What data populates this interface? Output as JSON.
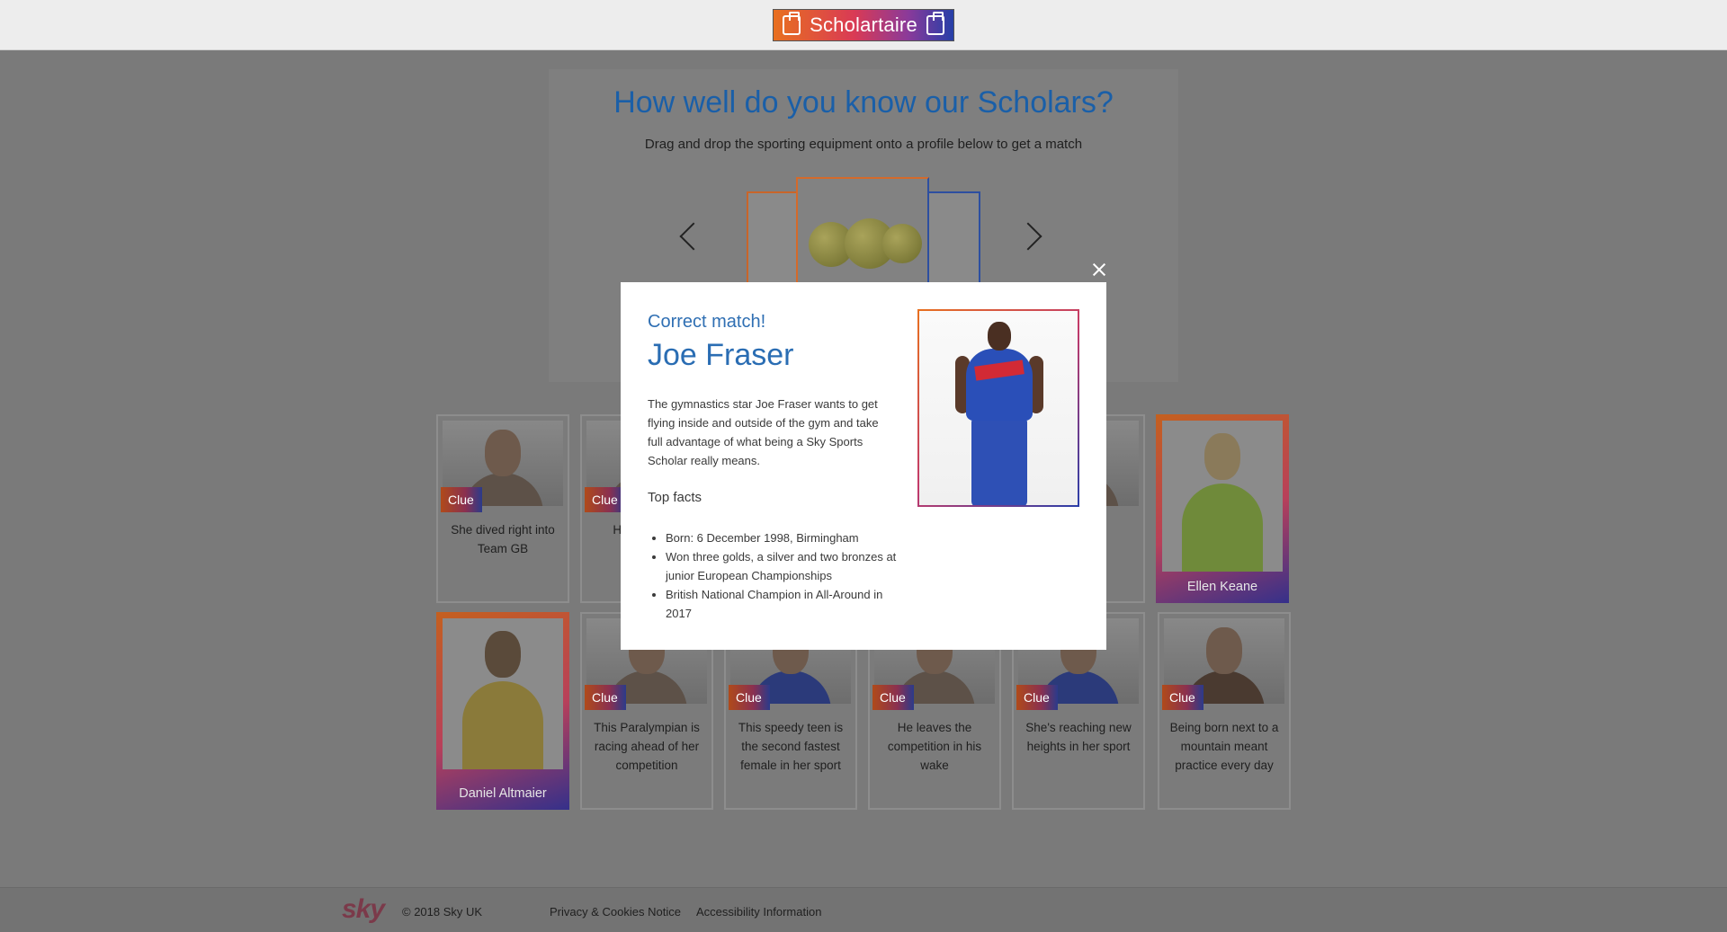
{
  "header": {
    "logo_text": "Scholartaire"
  },
  "game": {
    "title": "How well do you know our Scholars?",
    "subtitle": "Drag and drop the sporting equipment onto a profile below to get a match"
  },
  "cards_row1": [
    {
      "clue": "Clue",
      "hint": "She dived right into Team GB"
    },
    {
      "clue": "Clue",
      "hint": "He's... afte..."
    },
    {
      "name": "Ellen Keane"
    }
  ],
  "cards_row2": [
    {
      "name": "Daniel Altmaier"
    },
    {
      "clue": "Clue",
      "hint": "This Paralympian is racing ahead of her competition"
    },
    {
      "clue": "Clue",
      "hint": "This speedy teen is the second fastest female in her sport"
    },
    {
      "clue": "Clue",
      "hint": "He leaves the competition in his wake"
    },
    {
      "clue": "Clue",
      "hint": "She's reaching new heights in her sport"
    },
    {
      "clue": "Clue",
      "hint": "Being born next to a mountain meant practice every day"
    }
  ],
  "modal": {
    "status": "Correct match!",
    "name": "Joe Fraser",
    "description": "The gymnastics star Joe Fraser wants to get flying inside and outside of the gym and take full advantage of what being a Sky Sports Scholar really means.",
    "facts_title": "Top facts",
    "facts": [
      "Born: 6 December 1998, Birmingham",
      "Won three golds, a silver and two bronzes at junior European Championships",
      "British National Champion in All-Around in 2017"
    ]
  },
  "footer": {
    "logo": "sky",
    "copyright": "© 2018 Sky UK",
    "links": [
      "Privacy & Cookies Notice",
      "Accessibility Information"
    ]
  },
  "colors": {
    "accent_blue": "#2a6db3",
    "brand_orange": "#e8701f",
    "brand_navy": "#263fa8"
  }
}
